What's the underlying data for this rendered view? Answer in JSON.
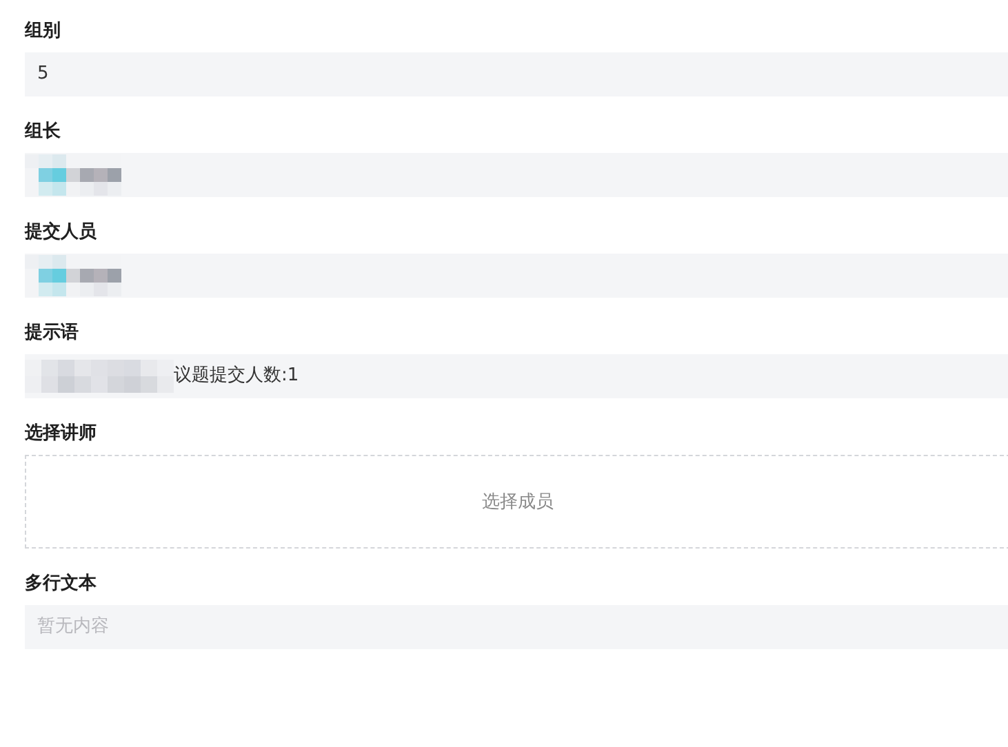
{
  "fields": [
    {
      "label": "组别",
      "kind": "text",
      "value": "5"
    },
    {
      "label": "组长",
      "kind": "masked_person"
    },
    {
      "label": "提交人员",
      "kind": "masked_person"
    },
    {
      "label": "提示语",
      "kind": "masked_text",
      "value": "议题提交人数:1"
    },
    {
      "label": "选择讲师",
      "kind": "picker",
      "action": "选择成员"
    },
    {
      "label": "多行文本",
      "kind": "textarea",
      "placeholder": "暂无内容"
    }
  ]
}
